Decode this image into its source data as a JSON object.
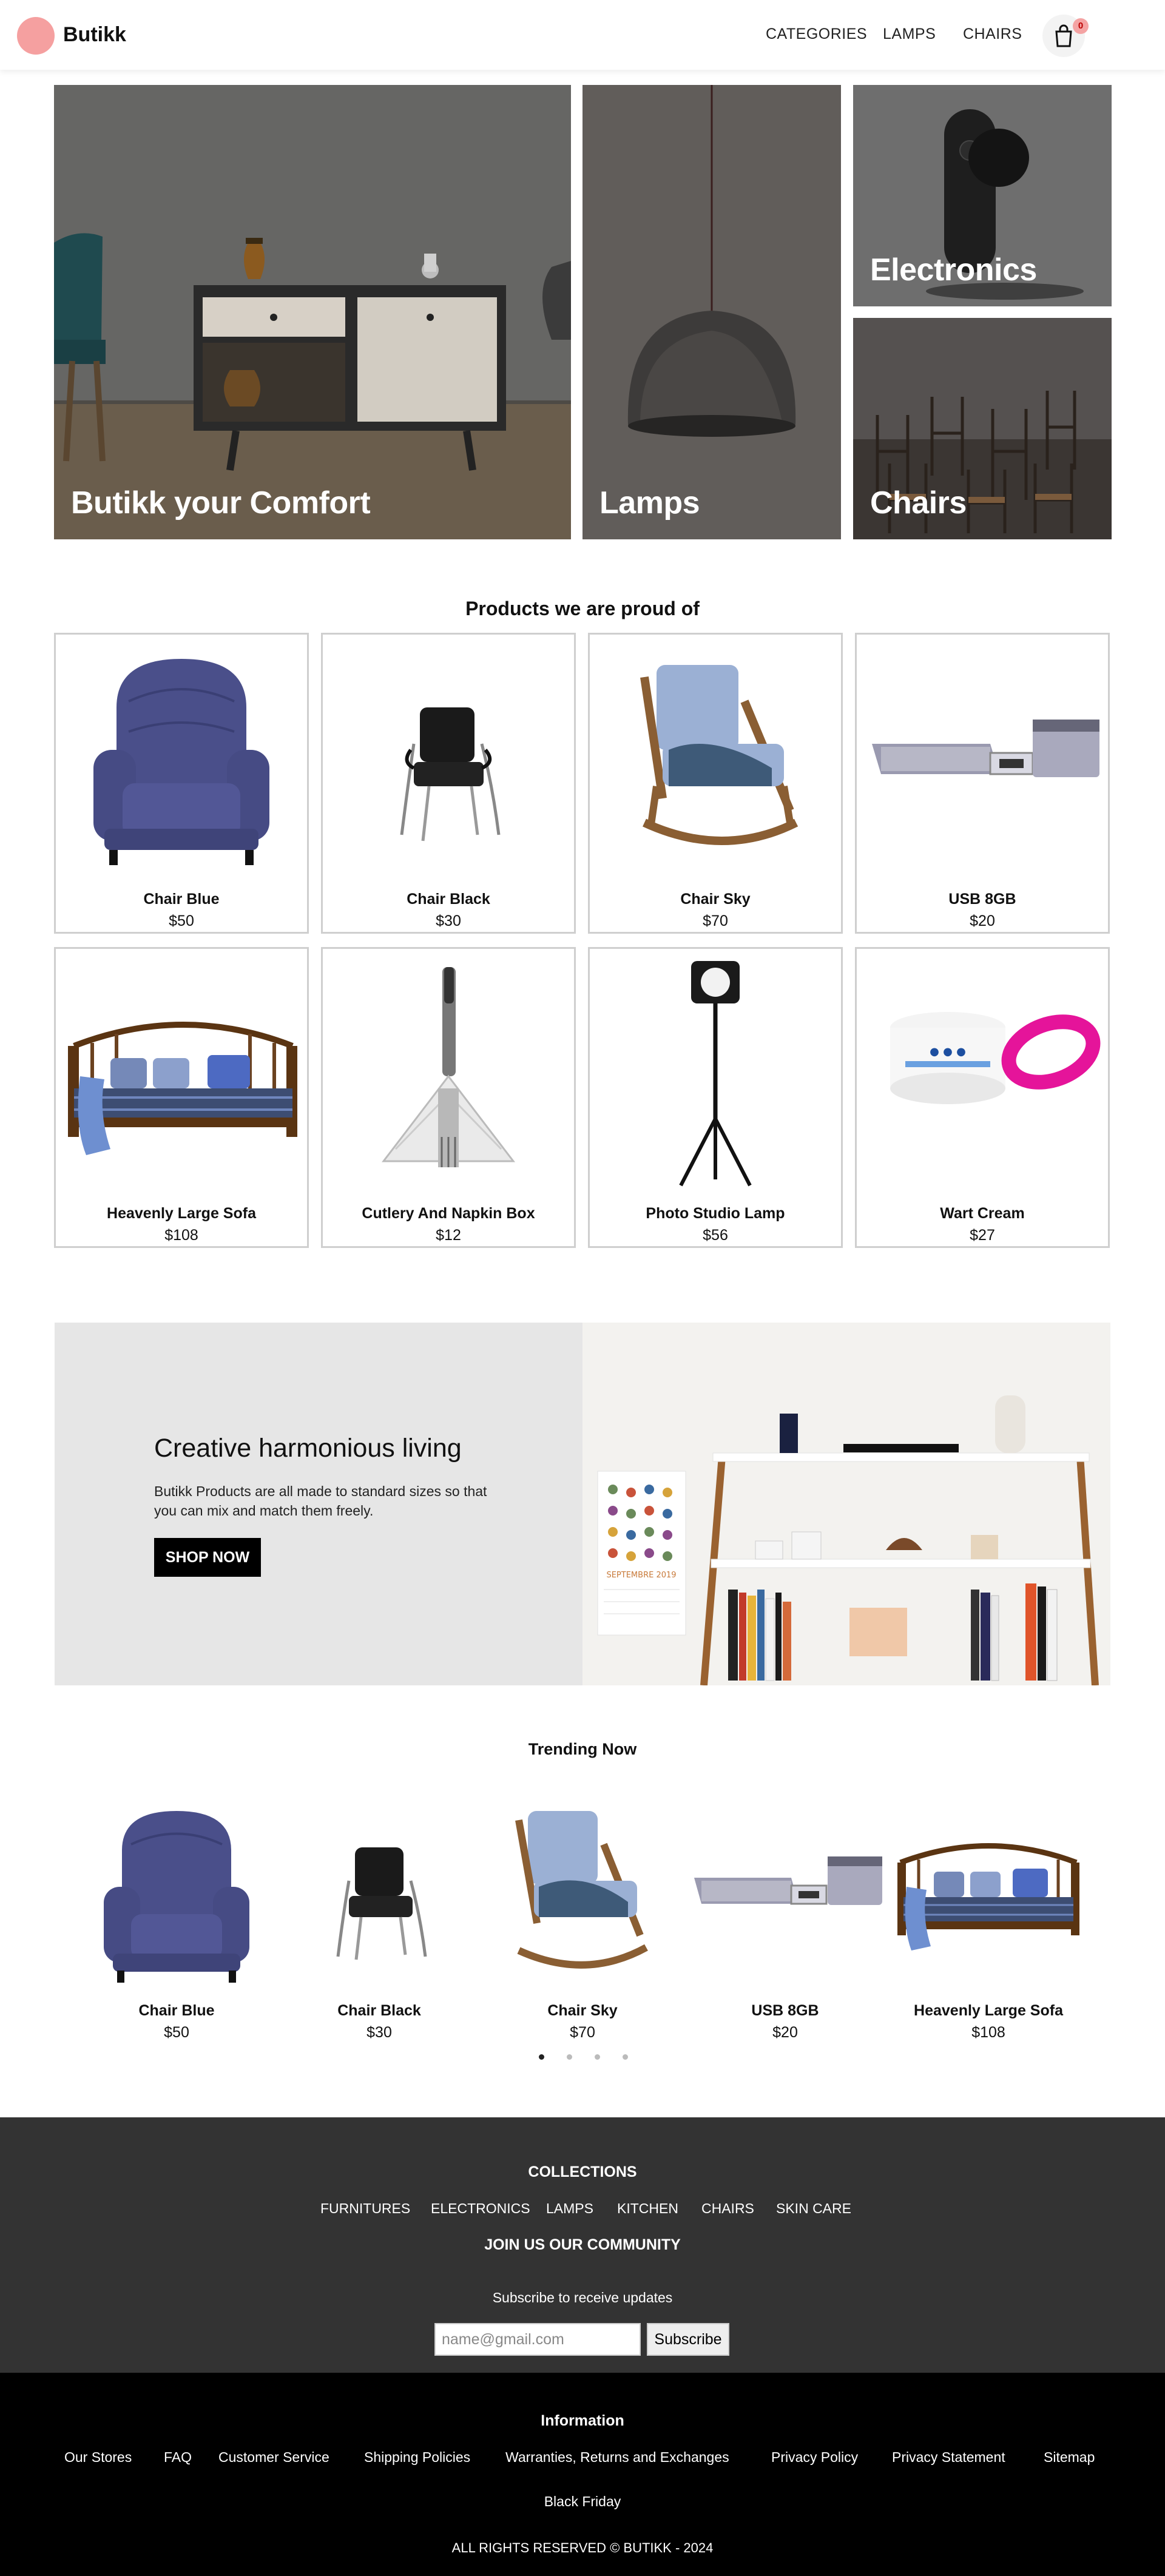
{
  "nav": {
    "brand": "Butikk",
    "links": [
      "CATEGORIES",
      "LAMPS",
      "CHAIRS"
    ],
    "cart_count": "0"
  },
  "hero": {
    "tiles": [
      "Butikk your Comfort",
      "Lamps",
      "Electronics",
      "Chairs"
    ]
  },
  "featured": {
    "title": "Products we are proud of",
    "products": [
      {
        "name": "Chair Blue",
        "price": "$50"
      },
      {
        "name": "Chair Black",
        "price": "$30"
      },
      {
        "name": "Chair Sky",
        "price": "$70"
      },
      {
        "name": "USB 8GB",
        "price": "$20"
      },
      {
        "name": "Heavenly Large Sofa",
        "price": "$108"
      },
      {
        "name": "Cutlery And Napkin Box",
        "price": "$12"
      },
      {
        "name": "Photo Studio Lamp",
        "price": "$56"
      },
      {
        "name": "Wart Cream",
        "price": "$27"
      }
    ]
  },
  "promo": {
    "title": "Creative harmonious living",
    "text": "Butikk Products are all made to standard sizes so that you can mix and match them freely.",
    "button": "SHOP NOW",
    "calendar_text": "SEPTEMBRE 2019"
  },
  "trending": {
    "title": "Trending Now",
    "items": [
      {
        "name": "Chair Blue",
        "price": "$50"
      },
      {
        "name": "Chair Black",
        "price": "$30"
      },
      {
        "name": "Chair Sky",
        "price": "$70"
      },
      {
        "name": "USB 8GB",
        "price": "$20"
      },
      {
        "name": "Heavenly Large Sofa",
        "price": "$108"
      }
    ]
  },
  "footer": {
    "collections_title": "COLLECTIONS",
    "collections": [
      "FURNITURES",
      "ELECTRONICS",
      "LAMPS",
      "KITCHEN",
      "CHAIRS",
      "SKIN CARE"
    ],
    "community_title": "JOIN US OUR COMMUNITY",
    "subscribe_text": "Subscribe to receive updates",
    "email_placeholder": "name@gmail.com",
    "subscribe_button": "Subscribe",
    "info_title": "Information",
    "info_links": [
      "Our Stores",
      "FAQ",
      "Customer Service",
      "Shipping Policies",
      "Warranties, Returns and Exchanges",
      "Privacy Policy",
      "Privacy Statement",
      "Sitemap"
    ],
    "black_friday": "Black Friday",
    "copyright": "ALL RIGHTS RESERVED © BUTIKK - 2024"
  },
  "colors": {
    "logo_dot": "#f5a0a0",
    "footer_top": "#333333",
    "footer_bottom": "#000000",
    "promo_bg": "#e6e6e6"
  }
}
